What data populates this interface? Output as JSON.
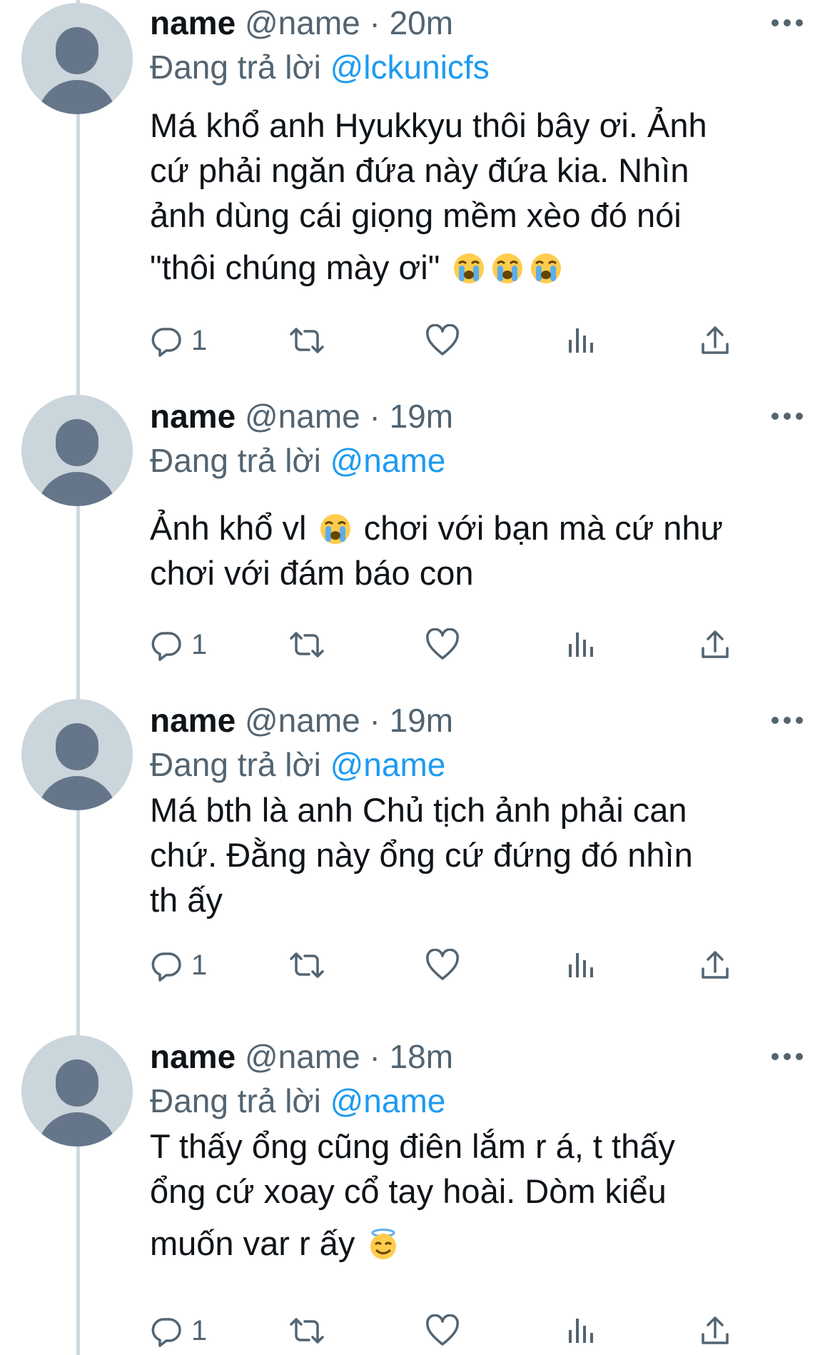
{
  "tweets": [
    {
      "name": "name",
      "handle": "@name",
      "time": "· 20m",
      "reply_prefix": "Đang trả lời",
      "reply_to": "@lckunicfs",
      "lines": [
        "Má khổ anh Hyukkyu thôi bây ơi. Ảnh",
        "cứ phải ngăn đứa này đứa kia. Nhìn",
        "ảnh dùng cái giọng mềm xèo đó nói",
        "\"thôi chúng mày ơi\""
      ],
      "reply_count": "1"
    },
    {
      "name": "name",
      "handle": "@name",
      "time": "· 19m",
      "reply_prefix": "Đang trả lời",
      "reply_to": "@name",
      "lines_a": "Ảnh khổ vl",
      "lines_b": " chơi với bạn mà cứ như",
      "line2": "chơi với đám báo con",
      "reply_count": "1"
    },
    {
      "name": "name",
      "handle": "@name",
      "time": "· 19m",
      "reply_prefix": "Đang trả lời",
      "reply_to": "@name",
      "lines": [
        "Má bth là anh Chủ tịch ảnh phải can",
        "chứ. Đằng này ổng cứ đứng đó nhìn",
        "th ấy"
      ],
      "reply_count": "1"
    },
    {
      "name": "name",
      "handle": "@name",
      "time": "· 18m",
      "reply_prefix": "Đang trả lời",
      "reply_to": "@name",
      "lines": [
        "T thấy ổng cũng điên lắm r á, t thấy",
        "ổng cứ xoay cổ tay hoài. Dòm kiểu",
        "muốn var r ấy"
      ],
      "reply_count": "1"
    }
  ],
  "icons": {
    "more": "more-horizontal-icon",
    "reply": "reply-bubble-icon",
    "retweet": "retweet-icon",
    "like": "heart-icon",
    "views": "analytics-bars-icon",
    "share": "share-upload-icon",
    "emoji_cry": "loudly-crying-face-emoji",
    "emoji_halo": "smiling-face-with-halo-emoji"
  },
  "colors": {
    "text": "#0f1419",
    "secondary": "#536471",
    "link": "#1d9bf0",
    "thread_line": "#cfd9de",
    "avatar_bg": "#cbd5dc",
    "avatar_fg": "#66768a"
  }
}
